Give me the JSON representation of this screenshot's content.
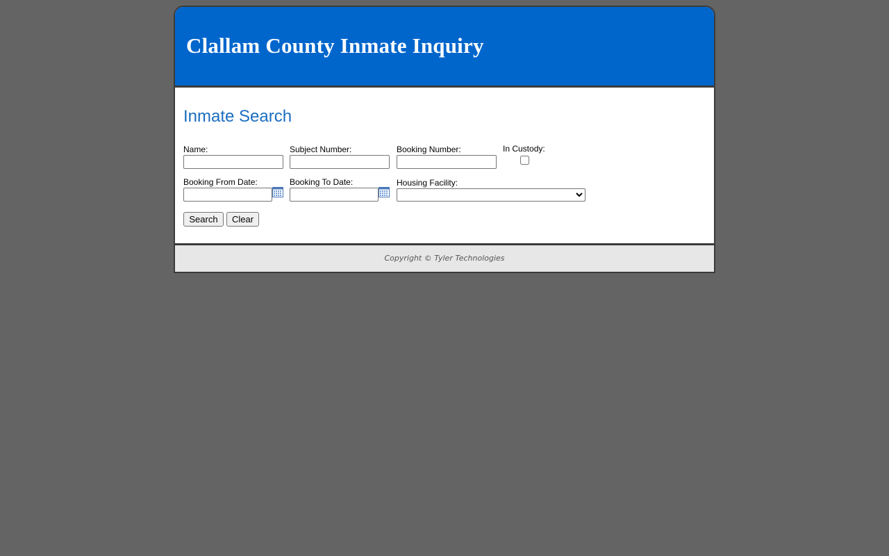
{
  "header": {
    "title": "Clallam County Inmate Inquiry"
  },
  "search": {
    "section_title": "Inmate Search",
    "fields": {
      "name": {
        "label": "Name:",
        "value": "",
        "placeholder": ""
      },
      "subject_number": {
        "label": "Subject Number:",
        "value": "",
        "placeholder": ""
      },
      "booking_number": {
        "label": "Booking Number:",
        "value": "",
        "placeholder": ""
      },
      "in_custody": {
        "label": "In Custody:",
        "checked": false
      },
      "booking_from_date": {
        "label": "Booking From Date:",
        "value": ""
      },
      "booking_to_date": {
        "label": "Booking To Date:",
        "value": ""
      },
      "housing_facility": {
        "label": "Housing Facility:",
        "selected": ""
      }
    },
    "buttons": {
      "search_label": "Search",
      "clear_label": "Clear"
    }
  },
  "footer": {
    "copyright": "Copyright © Tyler Technologies"
  },
  "colors": {
    "background": "#646464",
    "header_bg": "#0066cc",
    "section_title": "#1a6dc0",
    "footer_bg": "#e7e7e7"
  },
  "icons": {
    "calendar": "calendar-icon"
  }
}
